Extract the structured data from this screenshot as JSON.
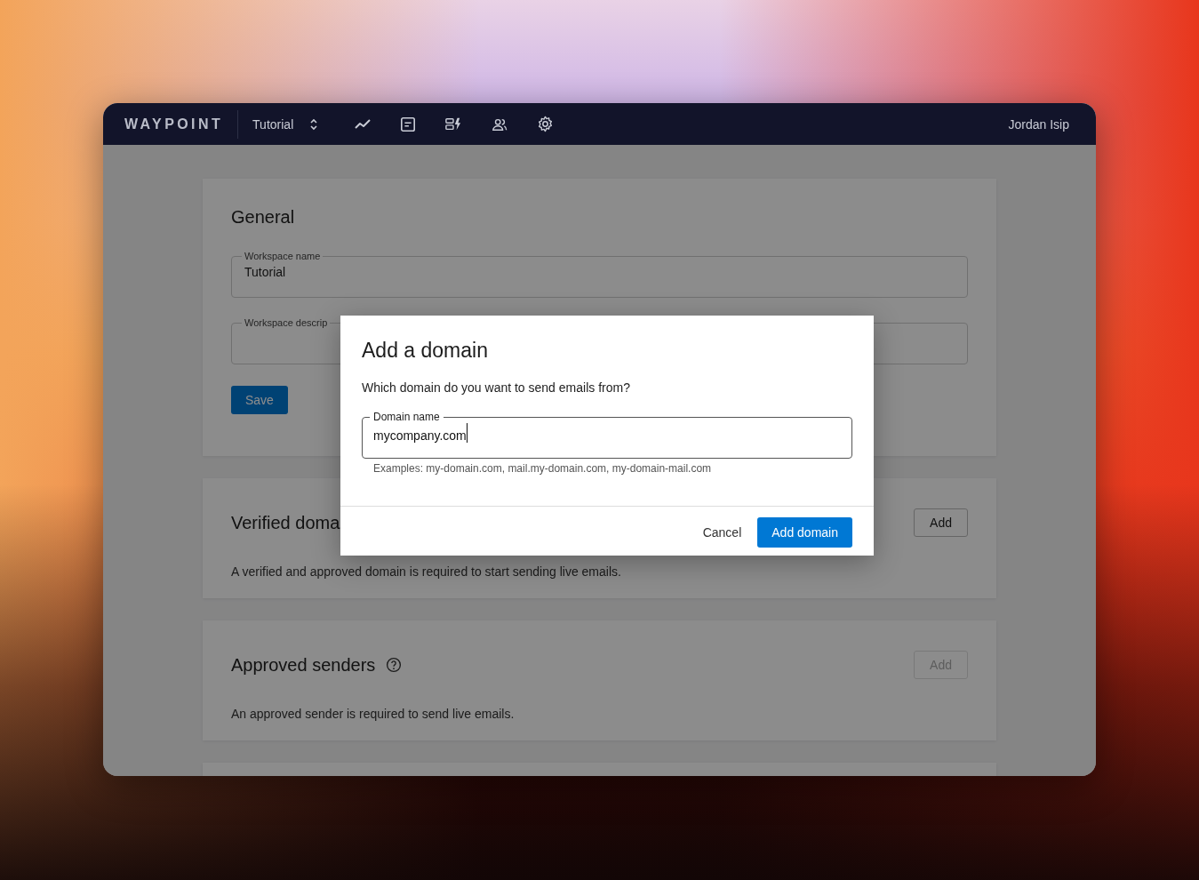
{
  "navbar": {
    "logo": "WAYPOINT",
    "workspace": "Tutorial",
    "user": "Jordan Isip"
  },
  "general": {
    "title": "General",
    "fields": [
      {
        "label": "Workspace name",
        "value": "Tutorial"
      },
      {
        "label": "Workspace descrip"
      }
    ],
    "save": "Save"
  },
  "sections": [
    {
      "title": "Verified doma",
      "help": false,
      "button": {
        "label": "Add",
        "disabled": false
      },
      "description": "A verified and approved domain is required to start sending live emails."
    },
    {
      "title": "Approved senders",
      "help": true,
      "button": {
        "label": "Add",
        "disabled": true
      },
      "description": "An approved sender is required to send live emails."
    }
  ],
  "dialog": {
    "title": "Add a domain",
    "prompt": "Which domain do you want to send emails from?",
    "field": {
      "label": "Domain name",
      "value": "mycompany.com",
      "helper": "Examples: my-domain.com, mail.my-domain.com, my-domain-mail.com"
    },
    "cancel": "Cancel",
    "confirm": "Add domain"
  }
}
